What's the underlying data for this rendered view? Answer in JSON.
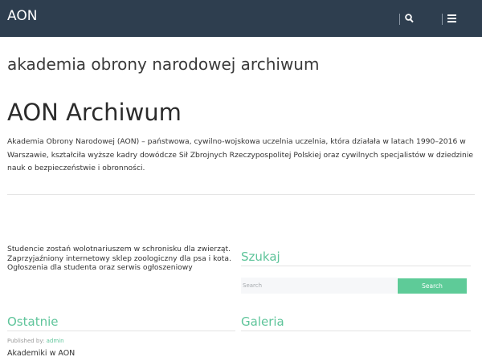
{
  "header": {
    "brand": "AON",
    "search_icon": "search-icon",
    "menu_icon": "menu-icon",
    "background": "#2e3e4f"
  },
  "site": {
    "tagline": "akademia obrony narodowej archiwum"
  },
  "article": {
    "title": "AON Archiwum",
    "intro": "Akademia Obrony Narodowej (AON) – państwowa, cywilno-wojskowa uczelnia uczelnia, która działała w latach 1990–2016 w Warszawie, kształciła wyższe kadry dowódcze Sił Zbrojnych Rzeczypospolitej Polskiej oraz cywilnych specjalistów w dziedzinie nauk o bezpieczeństwie i obronności."
  },
  "promo": {
    "lines": [
      "Studencie zostań wolotnariuszem w schronisku dla zwierząt.",
      "Zaprzyjaźniony internetowy sklep zoologiczny dla psa i kota.",
      "Ogłoszenia dla studenta oraz serwis ogłoszeniowy"
    ]
  },
  "search_widget": {
    "title": "Szukaj",
    "placeholder": "Search",
    "button_label": "Search"
  },
  "recent_widget": {
    "title": "Ostatnie",
    "published_by_label": "Published by:",
    "author": "admin",
    "post_title": "Akademiki w AON"
  },
  "gallery_widget": {
    "title": "Galeria"
  },
  "colors": {
    "accent": "#5ec49a",
    "button": "#5ecb98"
  }
}
